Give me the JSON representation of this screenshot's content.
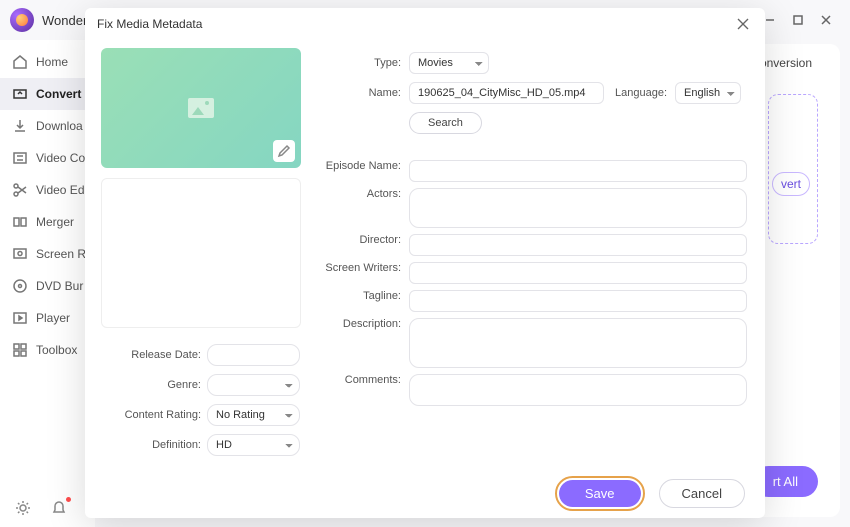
{
  "app": {
    "title": "Wonder"
  },
  "window_controls": {
    "min": "—",
    "max": "☐",
    "close": "✕"
  },
  "sidebar": {
    "items": [
      {
        "label": "Home"
      },
      {
        "label": "Convert"
      },
      {
        "label": "Downloa"
      },
      {
        "label": "Video Co"
      },
      {
        "label": "Video Ed"
      },
      {
        "label": "Merger"
      },
      {
        "label": "Screen R"
      },
      {
        "label": "DVD Bur"
      },
      {
        "label": "Player"
      },
      {
        "label": "Toolbox"
      }
    ]
  },
  "background": {
    "tab": "Conversion",
    "vert_btn": "vert",
    "start_all": "rt All"
  },
  "modal": {
    "title": "Fix Media Metadata",
    "type_label": "Type:",
    "type_value": "Movies",
    "name_label": "Name:",
    "name_value": "190625_04_CityMisc_HD_05.mp4",
    "language_label": "Language:",
    "language_value": "English",
    "search_label": "Search",
    "fields": {
      "episode_name": "Episode Name:",
      "actors": "Actors:",
      "director": "Director:",
      "screen_writers": "Screen Writers:",
      "tagline": "Tagline:",
      "description": "Description:",
      "comments": "Comments:"
    },
    "left_fields": {
      "release_date": "Release Date:",
      "genre": "Genre:",
      "content_rating": "Content Rating:",
      "content_rating_value": "No Rating",
      "definition": "Definition:",
      "definition_value": "HD"
    },
    "save": "Save",
    "cancel": "Cancel"
  }
}
